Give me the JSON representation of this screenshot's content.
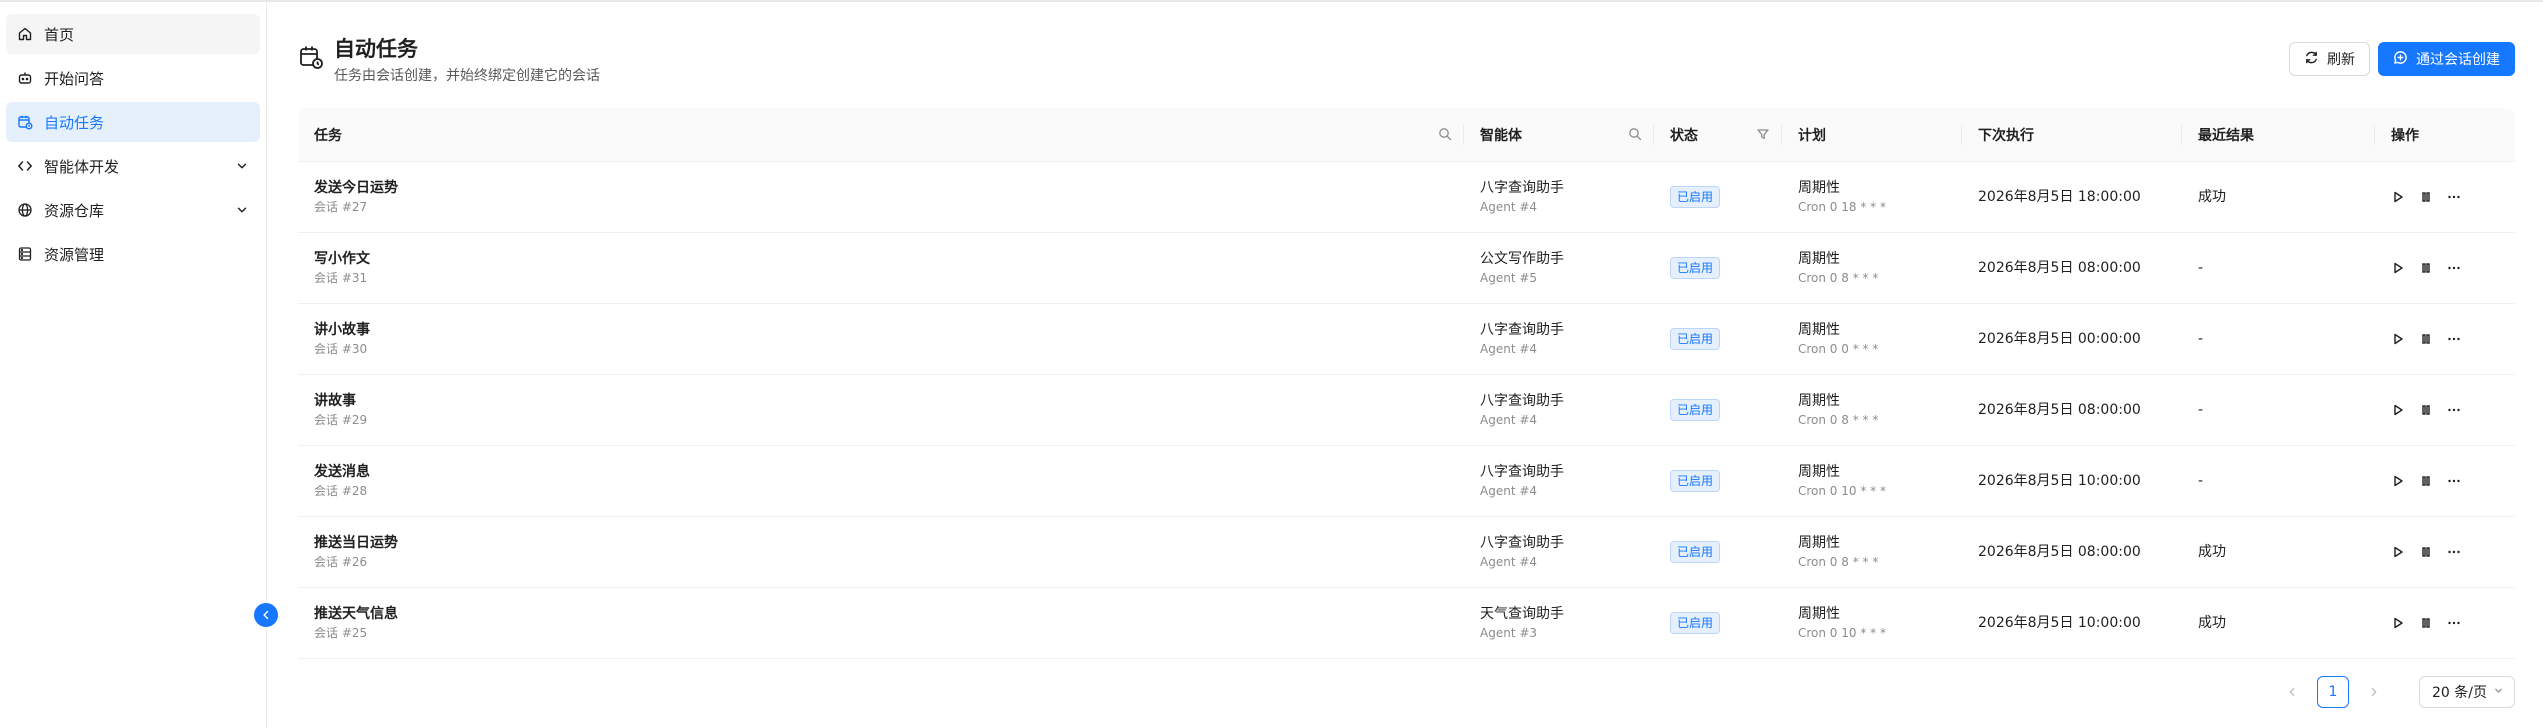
{
  "sidebar": {
    "items": [
      {
        "label": "首页",
        "icon": "home-icon"
      },
      {
        "label": "开始问答",
        "icon": "bot-icon"
      },
      {
        "label": "自动任务",
        "icon": "calendar-clock-icon",
        "active": true
      },
      {
        "label": "智能体开发",
        "icon": "code-icon",
        "expandable": true
      },
      {
        "label": "资源仓库",
        "icon": "globe-icon",
        "expandable": true
      },
      {
        "label": "资源管理",
        "icon": "database-icon"
      }
    ]
  },
  "header": {
    "title": "自动任务",
    "subtitle": "任务由会话创建，并始终绑定创建它的会话"
  },
  "toolbar": {
    "refresh_label": "刷新",
    "create_label": "通过会话创建"
  },
  "table": {
    "columns": {
      "task": "任务",
      "agent": "智能体",
      "status": "状态",
      "plan": "计划",
      "next": "下次执行",
      "result": "最近结果",
      "ops": "操作"
    },
    "rows": [
      {
        "name": "发送今日运势",
        "session": "会话 #27",
        "agent": "八字查询助手",
        "agent_id": "Agent #4",
        "status": "已启用",
        "plan": "周期性",
        "cron": "Cron 0 18 * * *",
        "next": "2026年8月5日 18:00:00",
        "result": "成功"
      },
      {
        "name": "写小作文",
        "session": "会话 #31",
        "agent": "公文写作助手",
        "agent_id": "Agent #5",
        "status": "已启用",
        "plan": "周期性",
        "cron": "Cron 0 8 * * *",
        "next": "2026年8月5日 08:00:00",
        "result": "-"
      },
      {
        "name": "讲小故事",
        "session": "会话 #30",
        "agent": "八字查询助手",
        "agent_id": "Agent #4",
        "status": "已启用",
        "plan": "周期性",
        "cron": "Cron 0 0 * * *",
        "next": "2026年8月5日 00:00:00",
        "result": "-"
      },
      {
        "name": "讲故事",
        "session": "会话 #29",
        "agent": "八字查询助手",
        "agent_id": "Agent #4",
        "status": "已启用",
        "plan": "周期性",
        "cron": "Cron 0 8 * * *",
        "next": "2026年8月5日 08:00:00",
        "result": "-"
      },
      {
        "name": "发送消息",
        "session": "会话 #28",
        "agent": "八字查询助手",
        "agent_id": "Agent #4",
        "status": "已启用",
        "plan": "周期性",
        "cron": "Cron 0 10 * * *",
        "next": "2026年8月5日 10:00:00",
        "result": "-"
      },
      {
        "name": "推送当日运势",
        "session": "会话 #26",
        "agent": "八字查询助手",
        "agent_id": "Agent #4",
        "status": "已启用",
        "plan": "周期性",
        "cron": "Cron 0 8 * * *",
        "next": "2026年8月5日 08:00:00",
        "result": "成功"
      },
      {
        "name": "推送天气信息",
        "session": "会话 #25",
        "agent": "天气查询助手",
        "agent_id": "Agent #3",
        "status": "已启用",
        "plan": "周期性",
        "cron": "Cron 0 10 * * *",
        "next": "2026年8月5日 10:00:00",
        "result": "成功"
      }
    ]
  },
  "pagination": {
    "current": "1",
    "page_size": "20 条/页"
  },
  "colors": {
    "accent": "#1677ff",
    "active_bg": "#e6f0fd"
  }
}
